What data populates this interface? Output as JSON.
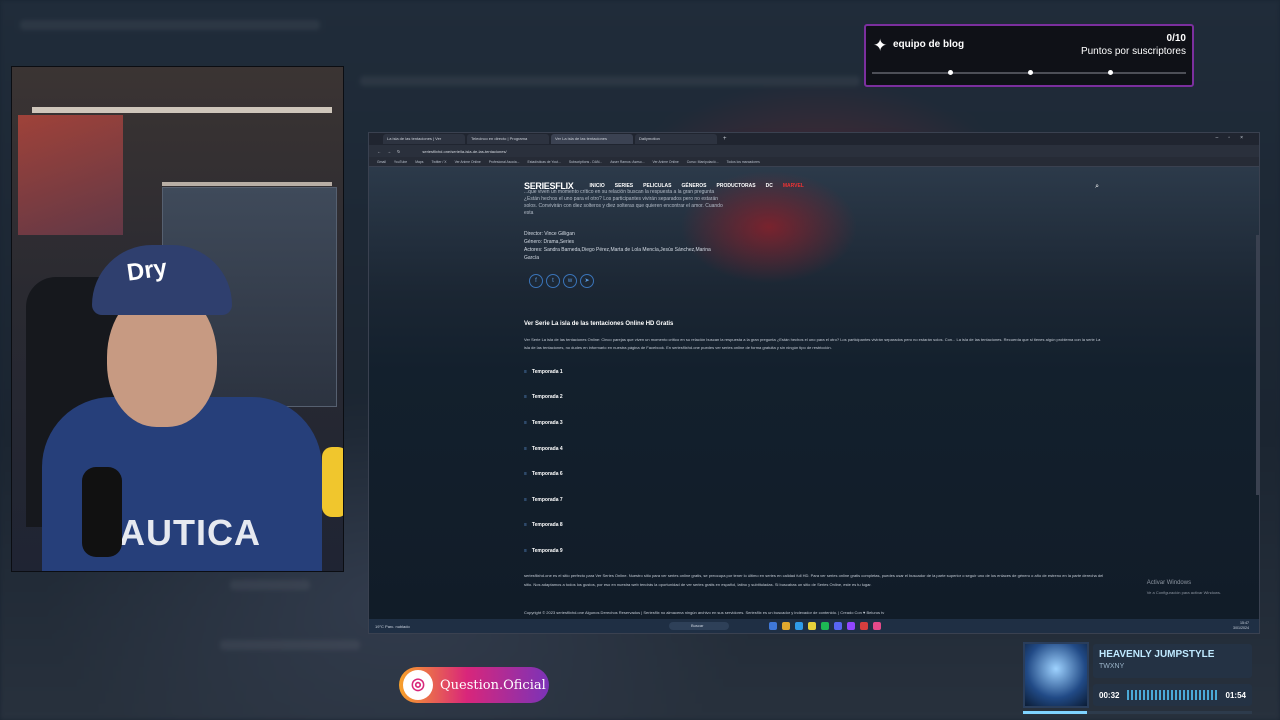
{
  "goal_widget": {
    "title": "equipo de blog",
    "count": "0/10",
    "subtitle": "Puntos por suscriptores"
  },
  "browser": {
    "tabs": [
      "La isla de las tentaciones | Ver",
      "Telecinco en directo | Programa",
      "Ver La isla de las tentaciones",
      "Dailymotion"
    ],
    "url": "seriesflixhd.one/serie/la-isla-de-las-tentaciones/",
    "bookmarks": [
      "Gmail",
      "YouTube",
      "Maps",
      "Twitter / X",
      "Ver Anime Online",
      "Profesional Asocia...",
      "Estadísticas de Yout...",
      "Subscriptions - DAN...",
      "Asser Ramos: Aseso...",
      "Ver Anime Online",
      "Curso: Manipulació...",
      "Todos los marcadores"
    ]
  },
  "site": {
    "logo": "SERIESFLIX",
    "nav": [
      "INICIO",
      "SERIES",
      "PELICULAS",
      "GÉNEROS",
      "PRODUCTORAS",
      "DC",
      "MARVEL"
    ],
    "synopsis": "...que viven un momento crítico en su relación buscan la respuesta a la gran pregunta ¿Están hechos el uno para el otro? Los participantes vivirán separados pero no estarán solos. Convivirán con diez solteros y diez solteras que quieren encontrar el amor. Cuando esta",
    "director": "Director: Vince Gilligan",
    "genre": "Género: Drama,Series",
    "actors": "Actores: Sandra Barneda,Diego Pérez,Marta de Lola Mencía,Jesús Sánchez,Marina García",
    "section_title": "Ver Serie La isla de las tentaciones Online HD Gratis",
    "description": "Ver Serie La isla de las tentaciones Online: Cinco parejas que viven un momento crítico en su relación buscan la respuesta a la gran pregunta ¿Están hechos el uno para el otro? Los participantes vivirán separados pero no estarán solos. Con... La isla de las tentaciones. Recuerda que si tienes algún problema con la serie La isla de las tentaciones, no dudes en informarlo en nuestra página de Facebook. En seriesflixhd.one puedes ver series online de forma gratuita y sin ningún tipo de restricción.",
    "seasons": [
      "Temporada 1",
      "Temporada 2",
      "Temporada 3",
      "Temporada 4",
      "Temporada 6",
      "Temporada 7",
      "Temporada 8",
      "Temporada 9"
    ],
    "footer_text": "seriesflixhd.one es el sitio perfecto para Ver Series Online. Nuestro sitio para ver series online gratis, se preocupa por tener lo último en series en calidad full HD. Para ver series online gratis completas, puedes usar el buscador de la parte superior o seguir uno de los enlaces de género o año de estreno en la parte derecha del sitio. Nos adaptamos a todos los gustos, por eso en nuestra web tendrás la oportunidad de ver series gratis en español, latino y subtituladas. Si buscabas un sitio de Series Online, este es tu lugar.",
    "copyright": "Copyright © 2023 seriesflixhd.one Algunos Derechos Reservados | Seriesflix no almacena ningún archivo en sus servidores. Seriesflix es un buscador y indexador de contenido. | Creado Con ♥ Beluros tv",
    "activate_title": "Activar Windows",
    "activate_sub": "Ve a Configuración para activar Windows."
  },
  "taskbar": {
    "weather": "19°C Parc. nublado",
    "search": "Buscar",
    "time": "15:47",
    "date": "3/01/2024"
  },
  "instagram": {
    "handle": "Question.Oficial"
  },
  "music": {
    "track": "HEAVENLY JUMPSTYLE",
    "artist": "TWXNY",
    "elapsed": "00:32",
    "duration": "01:54",
    "progress": 0.28
  },
  "webcam": {
    "shirt_text": "NAUTICA"
  }
}
